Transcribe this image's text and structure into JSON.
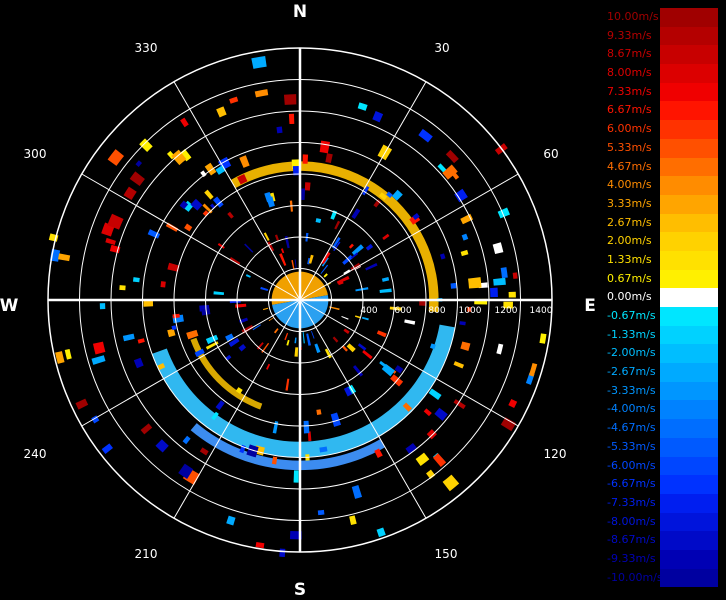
{
  "chart_data": {
    "type": "polar-radar-ppi",
    "title": "",
    "cardinals": [
      "N",
      "E",
      "S",
      "W"
    ],
    "azimuth_labels": [
      "30",
      "60",
      "120",
      "150",
      "210",
      "240",
      "300",
      "330"
    ],
    "range_labels": [
      "400",
      "600",
      "800",
      "1000",
      "1200",
      "1400"
    ],
    "range_max": 1600,
    "units": "m/s",
    "colorbar": [
      {
        "value": "10.00m/s",
        "color": "#a00000"
      },
      {
        "value": "9.33m/s",
        "color": "#b40000"
      },
      {
        "value": "8.67m/s",
        "color": "#c80000"
      },
      {
        "value": "8.00m/s",
        "color": "#dc0000"
      },
      {
        "value": "7.33m/s",
        "color": "#f00000"
      },
      {
        "value": "6.67m/s",
        "color": "#ff1400"
      },
      {
        "value": "6.00m/s",
        "color": "#ff3200"
      },
      {
        "value": "5.33m/s",
        "color": "#ff5000"
      },
      {
        "value": "4.67m/s",
        "color": "#ff6e00"
      },
      {
        "value": "4.00m/s",
        "color": "#ff8c00"
      },
      {
        "value": "3.33m/s",
        "color": "#ffa500"
      },
      {
        "value": "2.67m/s",
        "color": "#ffbe00"
      },
      {
        "value": "2.00m/s",
        "color": "#ffd200"
      },
      {
        "value": "1.33m/s",
        "color": "#ffe100"
      },
      {
        "value": "0.67m/s",
        "color": "#fff000"
      },
      {
        "value": "0.00m/s",
        "color": "#ffffff"
      },
      {
        "value": "-0.67m/s",
        "color": "#00e6ff"
      },
      {
        "value": "-1.33m/s",
        "color": "#00d2ff"
      },
      {
        "value": "-2.00m/s",
        "color": "#00beff"
      },
      {
        "value": "-2.67m/s",
        "color": "#00aaff"
      },
      {
        "value": "-3.33m/s",
        "color": "#0096ff"
      },
      {
        "value": "-4.00m/s",
        "color": "#0082ff"
      },
      {
        "value": "-4.67m/s",
        "color": "#006eff"
      },
      {
        "value": "-5.33m/s",
        "color": "#005aff"
      },
      {
        "value": "-6.00m/s",
        "color": "#0046ff"
      },
      {
        "value": "-6.67m/s",
        "color": "#0032ff"
      },
      {
        "value": "-7.33m/s",
        "color": "#001ef0"
      },
      {
        "value": "-8.00m/s",
        "color": "#0014dc"
      },
      {
        "value": "-8.67m/s",
        "color": "#000ac8"
      },
      {
        "value": "-9.33m/s",
        "color": "#0000b4"
      },
      {
        "value": "-10.00m/s",
        "color": "#0000a0"
      }
    ],
    "features": [
      {
        "name": "near-field",
        "range": [
          0,
          180
        ],
        "azimuth": [
          0,
          360
        ],
        "color_north": "#f0a000",
        "color_south": "#2aa0f0"
      },
      {
        "name": "yellow-ring",
        "range": [
          820,
          880
        ],
        "azimuth": [
          -30,
          95
        ],
        "color": "#e8b000"
      },
      {
        "name": "cyan-ring",
        "range": [
          900,
          1000
        ],
        "azimuth": [
          100,
          250
        ],
        "color": "#30b8f0"
      }
    ]
  }
}
